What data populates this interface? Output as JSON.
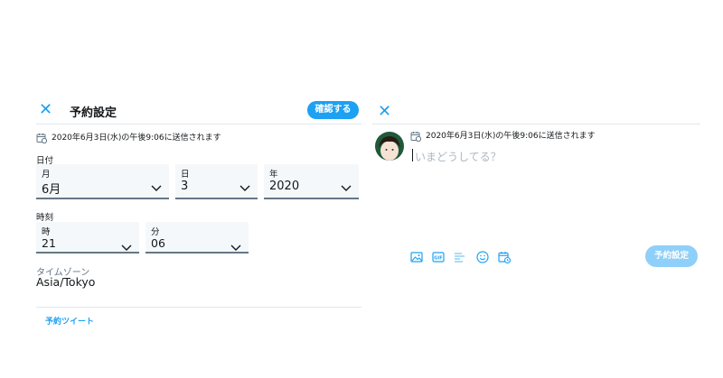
{
  "left": {
    "title": "予約設定",
    "confirm_label": "確認する",
    "schedule_note": "2020年6月3日(水)の午後9:06に送信されます",
    "date_section": "日付",
    "month": {
      "label": "月",
      "value": "6月"
    },
    "day": {
      "label": "日",
      "value": "3"
    },
    "year": {
      "label": "年",
      "value": "2020"
    },
    "time_section": "時刻",
    "hour": {
      "label": "時",
      "value": "21"
    },
    "minute": {
      "label": "分",
      "value": "06"
    },
    "timezone_label": "タイムゾーン",
    "timezone_value": "Asia/Tokyo",
    "scheduled_tweets_link": "予約ツイート"
  },
  "right": {
    "schedule_note": "2020年6月3日(水)の午後9:06に送信されます",
    "placeholder": "いまどうしてる？",
    "schedule_button": "予約設定",
    "toolbar_icons": [
      "image-icon",
      "gif-icon",
      "poll-icon",
      "emoji-icon",
      "schedule-icon"
    ]
  },
  "colors": {
    "accent": "#1da1f2",
    "accent_disabled": "#8ed0f9",
    "field_bg": "#f5f8fa"
  }
}
